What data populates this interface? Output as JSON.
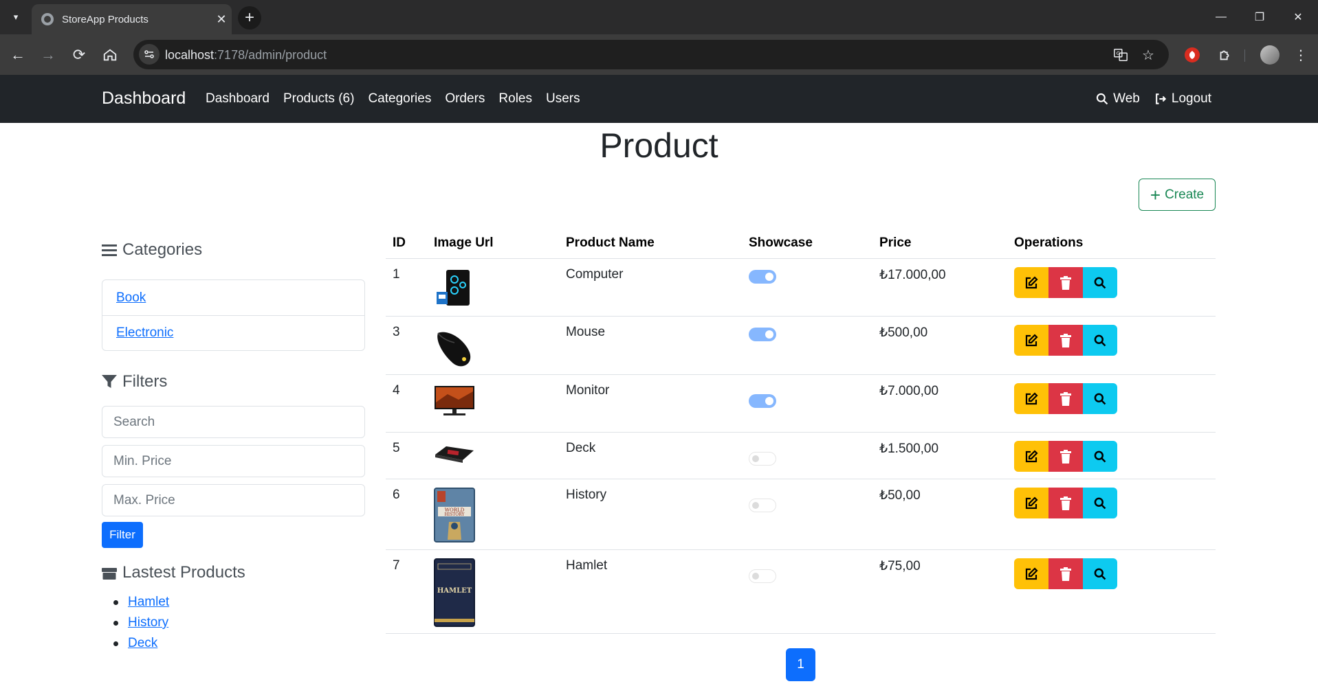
{
  "browser": {
    "tab_title": "StoreApp Products",
    "url_host": "localhost",
    "url_rest": ":7178/admin/product"
  },
  "navbar": {
    "brand": "Dashboard",
    "links": [
      "Dashboard",
      "Products (6)",
      "Categories",
      "Orders",
      "Roles",
      "Users"
    ],
    "web_label": "Web",
    "logout_label": "Logout"
  },
  "page": {
    "title": "Product",
    "create_label": "Create"
  },
  "sidebar": {
    "categories_heading": "Categories",
    "categories": [
      "Book",
      "Electronic"
    ],
    "filters_heading": "Filters",
    "search_placeholder": "Search",
    "min_price_placeholder": "Min. Price",
    "max_price_placeholder": "Max. Price",
    "filter_label": "Filter",
    "latest_heading": "Lastest Products",
    "latest": [
      "Hamlet",
      "History",
      "Deck"
    ]
  },
  "table": {
    "headers": [
      "ID",
      "Image Url",
      "Product Name",
      "Showcase",
      "Price",
      "Operations"
    ],
    "rows": [
      {
        "id": "1",
        "name": "Computer",
        "showcase": true,
        "price": "₺17.000,00",
        "image": "computer-image"
      },
      {
        "id": "3",
        "name": "Mouse",
        "showcase": true,
        "price": "₺500,00",
        "image": "mouse-image"
      },
      {
        "id": "4",
        "name": "Monitor",
        "showcase": true,
        "price": "₺7.000,00",
        "image": "monitor-image"
      },
      {
        "id": "5",
        "name": "Deck",
        "showcase": false,
        "price": "₺1.500,00",
        "image": "deck-image"
      },
      {
        "id": "6",
        "name": "History",
        "showcase": false,
        "price": "₺50,00",
        "image": "history-book-image"
      },
      {
        "id": "7",
        "name": "Hamlet",
        "showcase": false,
        "price": "₺75,00",
        "image": "hamlet-book-image"
      }
    ]
  },
  "pagination": {
    "current": "1"
  },
  "colors": {
    "primary": "#0d6efd",
    "warning": "#ffc107",
    "danger": "#dc3545",
    "info": "#0dcaf0",
    "success": "#198754",
    "navbar": "#212529"
  }
}
